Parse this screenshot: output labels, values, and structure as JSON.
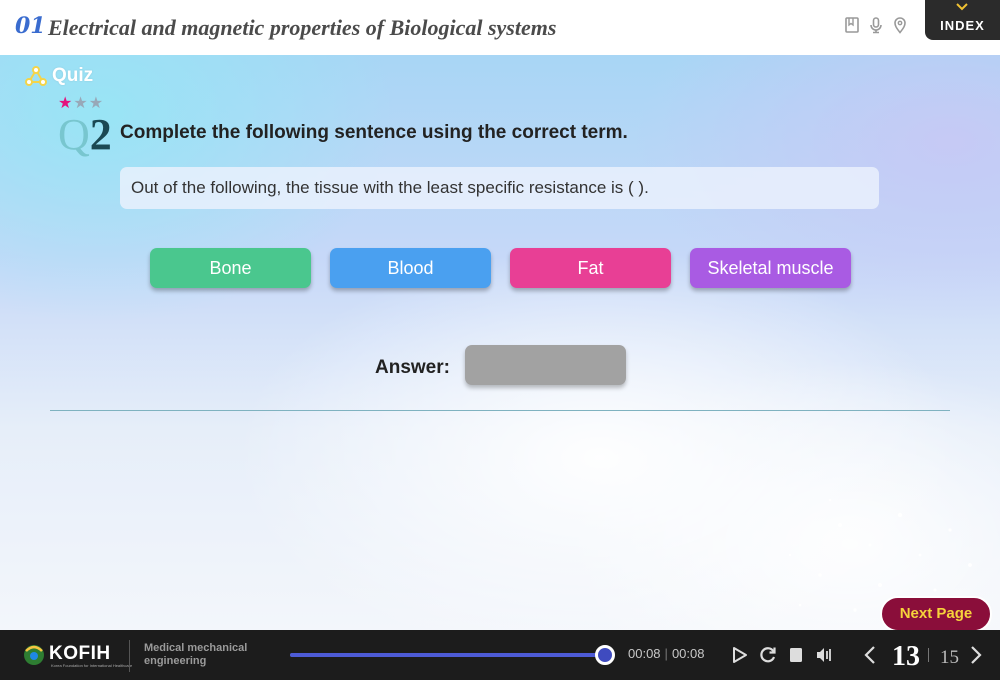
{
  "header": {
    "chapter_number": "01",
    "chapter_title": "Electrical and magnetic properties of Biological systems",
    "icons": [
      "bookmark-icon",
      "microphone-icon",
      "location-pin-icon"
    ],
    "index_label": "INDEX"
  },
  "quiz": {
    "label": "Quiz",
    "difficulty_stars": {
      "filled": 1,
      "total": 3
    },
    "question_prefix": "Q",
    "question_number": "2",
    "instruction": "Complete the following sentence using the correct term.",
    "sentence": "Out of the following, the tissue with the least specific resistance is (          ).",
    "choices": [
      {
        "label": "Bone",
        "color": "#4ac78e"
      },
      {
        "label": "Blood",
        "color": "#4aa0f0"
      },
      {
        "label": "Fat",
        "color": "#e83f95"
      },
      {
        "label": "Skeletal muscle",
        "color": "#a95be3"
      }
    ],
    "answer_label": "Answer:",
    "answer_value": ""
  },
  "next_page_label": "Next Page",
  "footer": {
    "logo_text": "KOFIH",
    "logo_subtext": "Korea Foundation for International Healthcare",
    "course_name": "Medical mechanical engineering",
    "progress": 1.0,
    "time_current": "00:08",
    "time_total": "00:08",
    "controls": [
      "play-icon",
      "replay-icon",
      "stop-icon",
      "volume-icon"
    ],
    "page_current": "13",
    "page_total": "15"
  },
  "colors": {
    "accent_blue": "#3a6ccf",
    "next_page_bg": "#8a0e3a",
    "next_page_text": "#f6d33b",
    "star_filled": "#e4127c"
  }
}
